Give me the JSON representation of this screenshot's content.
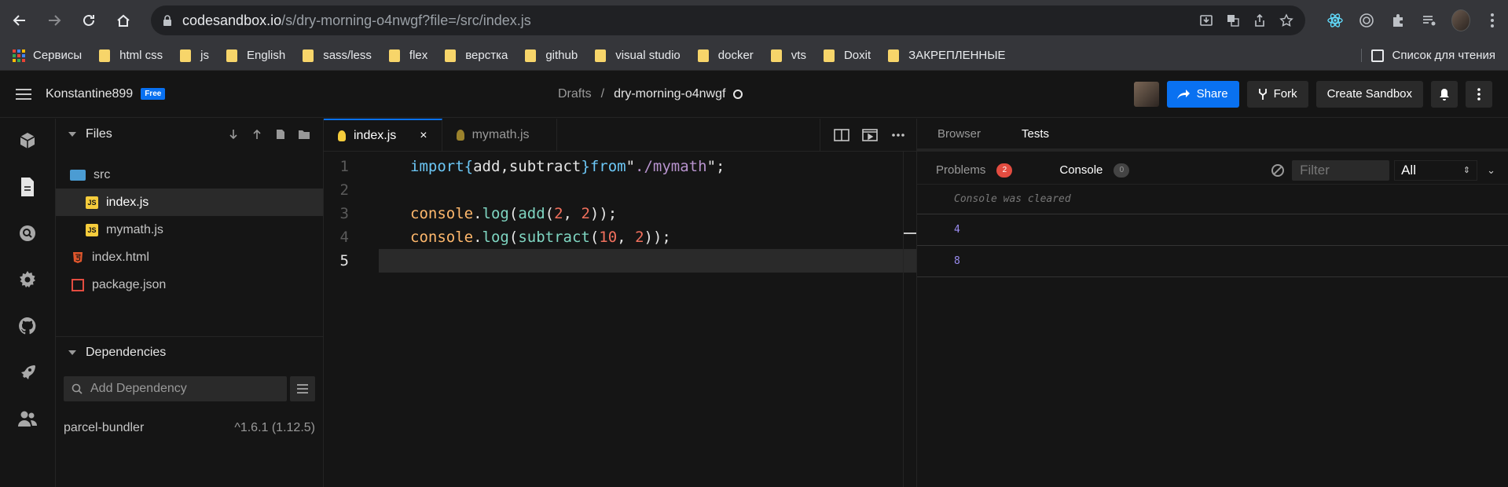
{
  "browser": {
    "url_host": "codesandbox.io",
    "url_path": "/s/dry-morning-o4nwgf?file=/src/index.js"
  },
  "bookmarks": {
    "items": [
      "Сервисы",
      "html css",
      "js",
      "English",
      "sass/less",
      "flex",
      "верстка",
      "github",
      "visual studio",
      "docker",
      "vts",
      "Doxit",
      "ЗАКРЕПЛЕННЫЕ"
    ],
    "reading_list": "Список для чтения"
  },
  "header": {
    "username": "Konstantine899",
    "plan_badge": "Free",
    "crumb_parent": "Drafts",
    "crumb_sep": "/",
    "sandbox_name": "dry-morning-o4nwgf",
    "share_label": "Share",
    "fork_label": "Fork",
    "create_label": "Create Sandbox"
  },
  "files_panel": {
    "title": "Files",
    "tree": [
      {
        "name": "src",
        "type": "folder"
      },
      {
        "name": "index.js",
        "type": "js",
        "selected": true
      },
      {
        "name": "mymath.js",
        "type": "js"
      },
      {
        "name": "index.html",
        "type": "html"
      },
      {
        "name": "package.json",
        "type": "json"
      }
    ]
  },
  "dependencies": {
    "title": "Dependencies",
    "placeholder": "Add Dependency",
    "items": [
      {
        "name": "parcel-bundler",
        "version": "^1.6.1 (1.12.5)"
      }
    ]
  },
  "editor": {
    "tabs": [
      {
        "label": "index.js",
        "active": true
      },
      {
        "label": "mymath.js",
        "active": false
      }
    ],
    "close_glyph": "×",
    "line_numbers": [
      "1",
      "2",
      "3",
      "4",
      "5"
    ]
  },
  "preview": {
    "tabs": [
      "Browser",
      "Tests"
    ],
    "active_tab": "Tests",
    "problems_label": "Problems",
    "problems_count": "2",
    "console_label": "Console",
    "console_count": "0",
    "filter_placeholder": "Filter",
    "level": "All",
    "console_lines": [
      "Console was cleared",
      "4",
      "8"
    ]
  }
}
